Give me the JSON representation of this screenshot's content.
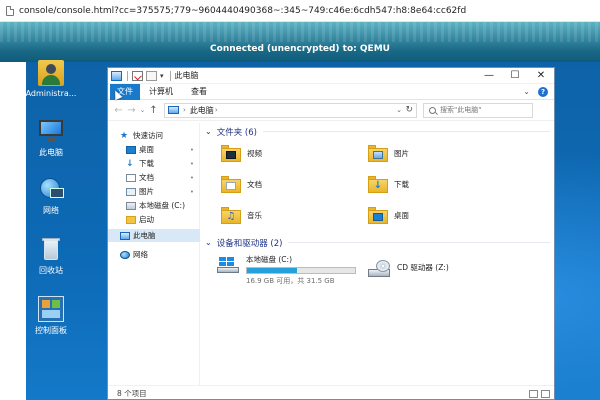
{
  "browser": {
    "url": "console/console.html?cc=375575;779~9604440490368~:345~749:c46e:6cdh547:h8:8e64:cc62fd"
  },
  "vnc": {
    "status": "Connected (unencrypted) to: QEMU"
  },
  "desktop": {
    "icons": [
      {
        "label": "Administra...",
        "icon": "user-folder-icon"
      },
      {
        "label": "此电脑",
        "icon": "this-pc-icon"
      },
      {
        "label": "网络",
        "icon": "network-icon"
      },
      {
        "label": "回收站",
        "icon": "recycle-bin-icon"
      },
      {
        "label": "控制面板",
        "icon": "control-panel-icon"
      }
    ]
  },
  "explorer": {
    "title": "此电脑",
    "ribbon_tabs": [
      "文件",
      "计算机",
      "查看"
    ],
    "address": "此电脑",
    "search_placeholder": "搜索\"此电脑\"",
    "nav_pane": {
      "quick_access": "快速访问",
      "items": [
        "桌面",
        "下载",
        "文档",
        "图片",
        "本地磁盘 (C:)",
        "启动"
      ],
      "this_pc": "此电脑",
      "network": "网络"
    },
    "groups": {
      "folders": "文件夹 (6)",
      "devices": "设备和驱动器 (2)"
    },
    "folders": [
      "视频",
      "图片",
      "文档",
      "下载",
      "音乐",
      "桌面"
    ],
    "drives": [
      {
        "name": "本地磁盘 (C:)",
        "free_text": "16.9 GB 可用，共 31.5 GB",
        "used_fraction": 0.46
      },
      {
        "name": "CD 驱动器 (Z:)"
      }
    ],
    "status": "8 个项目"
  }
}
